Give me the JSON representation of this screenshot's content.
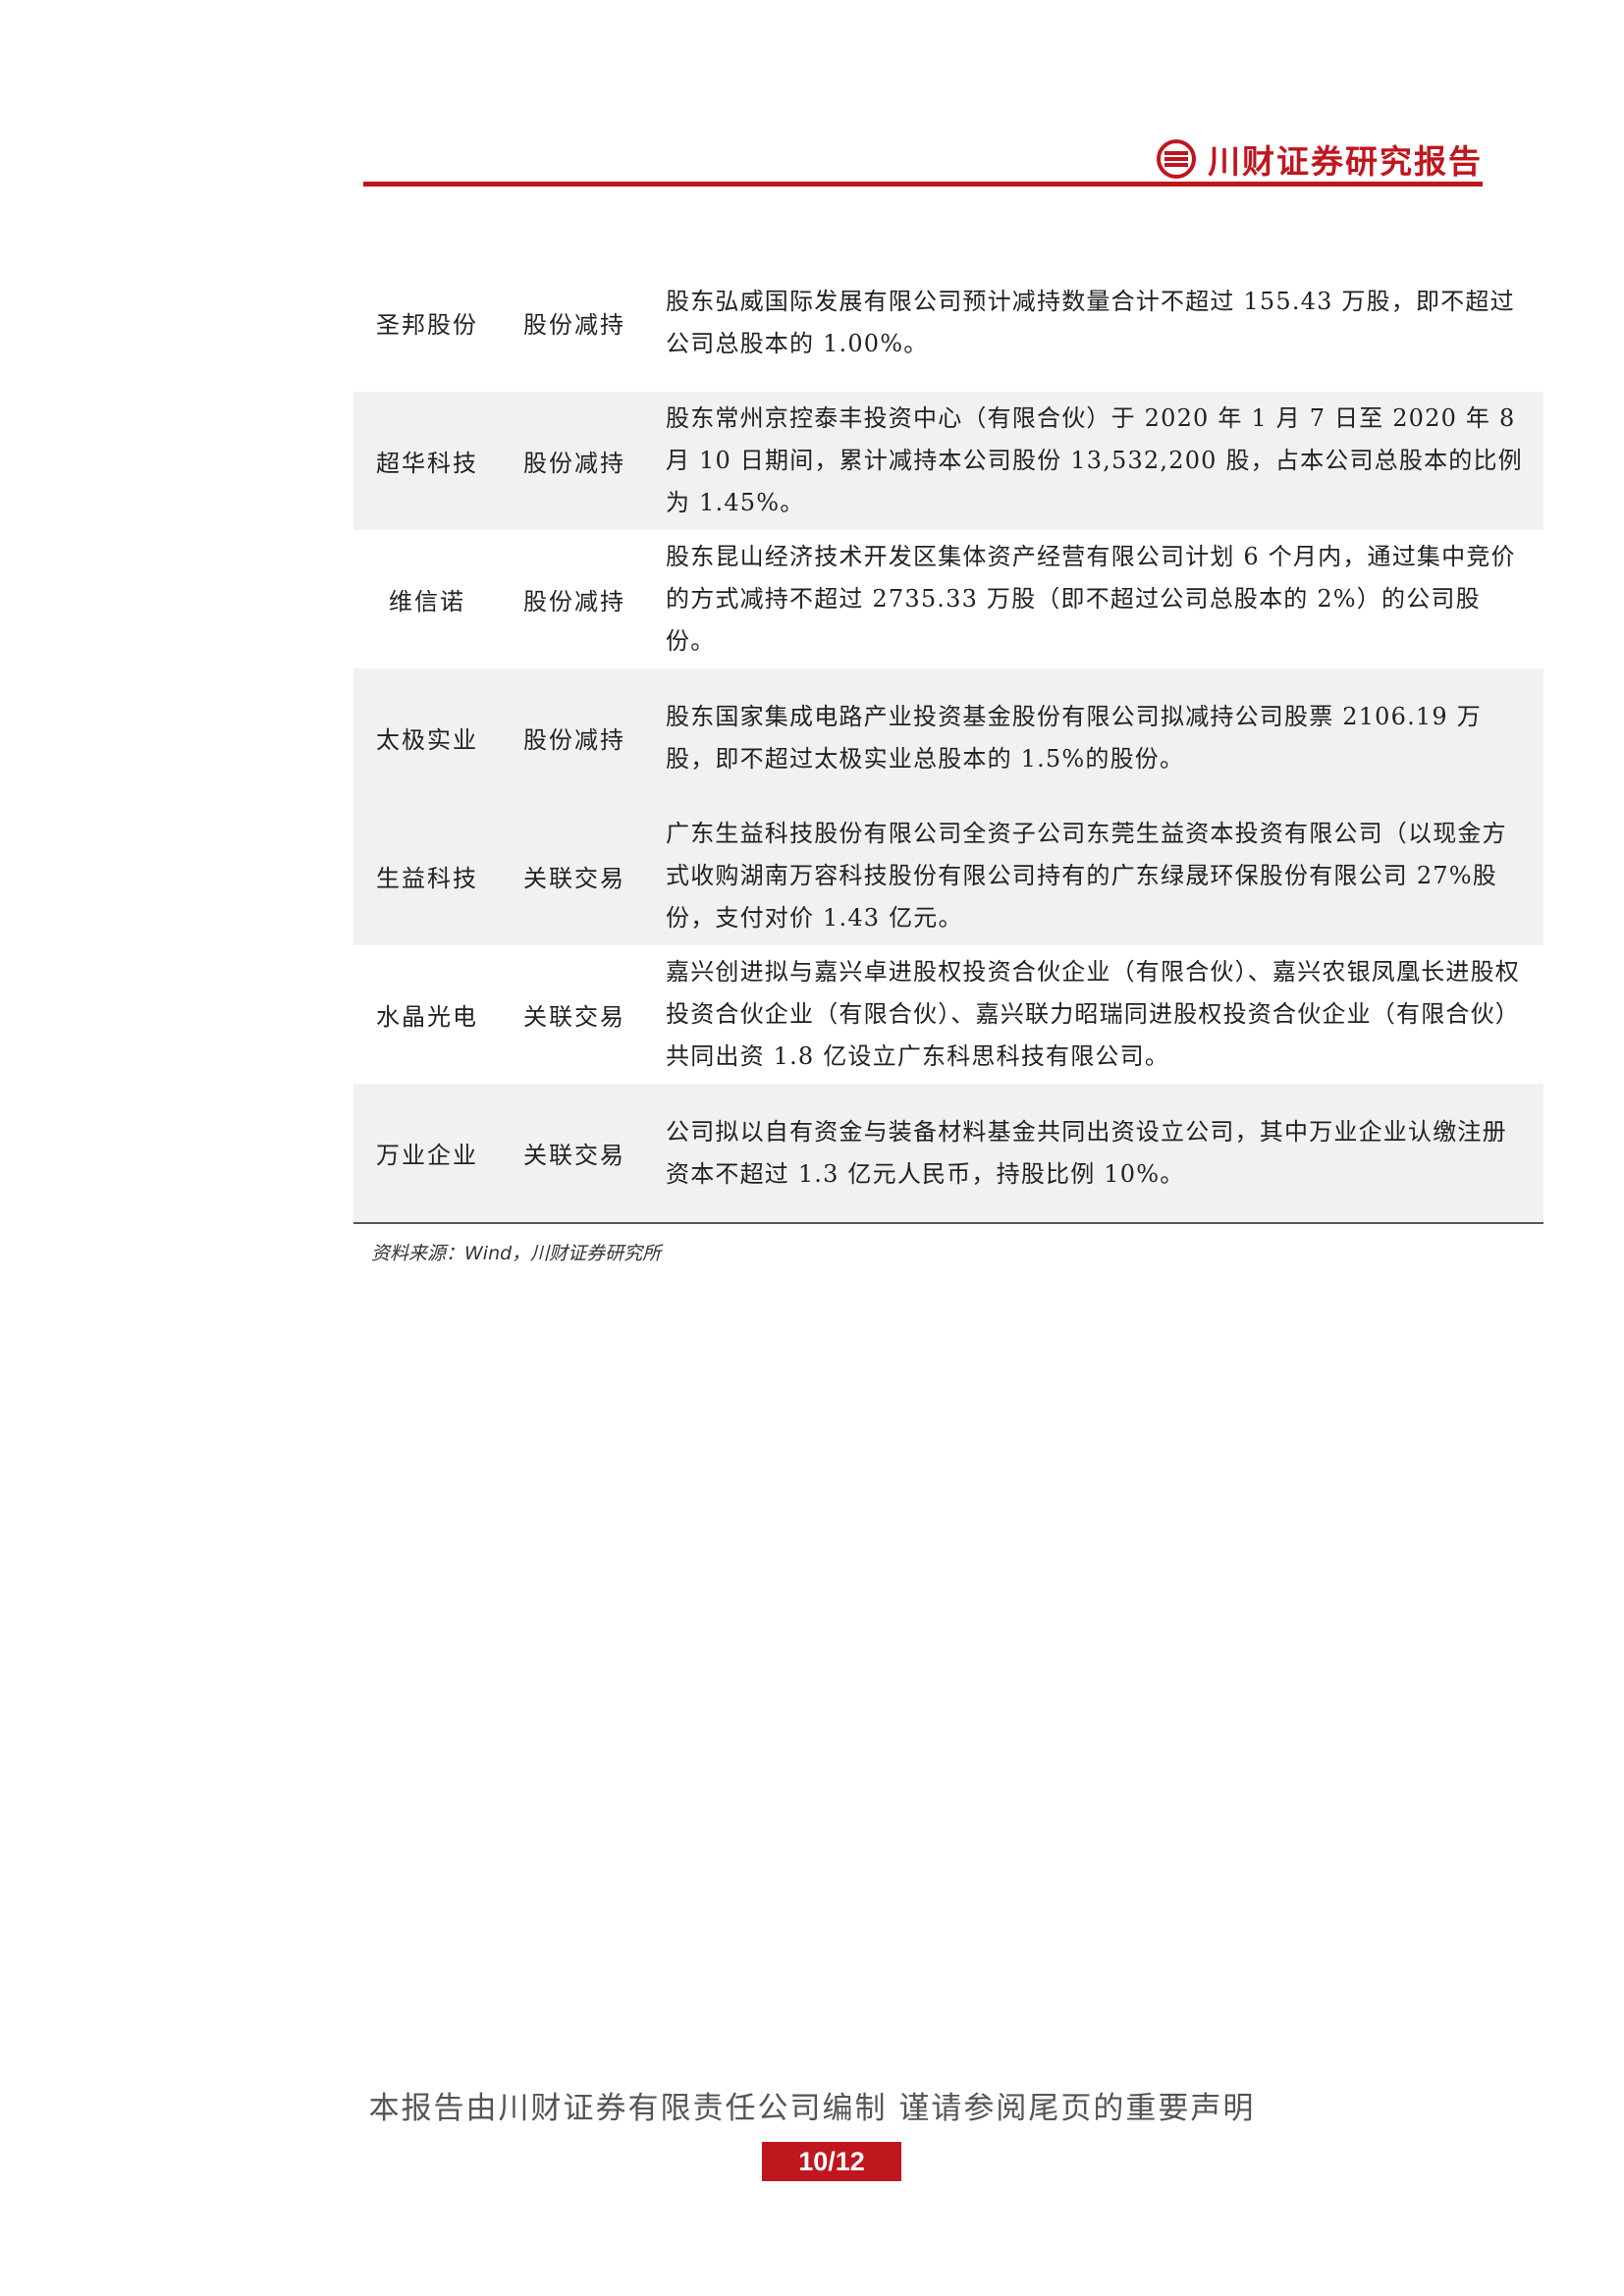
{
  "header": {
    "brand": "川财证券研究报告",
    "accent_color": "#c0161e",
    "logo_icon": "chuancai-logo-icon"
  },
  "table": {
    "rows": [
      {
        "company": "圣邦股份",
        "type": "股份减持",
        "description": "股东弘威国际发展有限公司预计减持数量合计不超过 155.43 万股，即不超过公司总股本的 1.00%。"
      },
      {
        "company": "超华科技",
        "type": "股份减持",
        "description": "股东常州京控泰丰投资中心（有限合伙）于 2020 年 1 月 7 日至 2020 年 8 月 10 日期间，累计减持本公司股份 13,532,200 股，占本公司总股本的比例为 1.45%。"
      },
      {
        "company": "维信诺",
        "type": "股份减持",
        "description": "股东昆山经济技术开发区集体资产经营有限公司计划 6 个月内，通过集中竞价的方式减持不超过 2735.33 万股（即不超过公司总股本的 2%）的公司股份。"
      },
      {
        "company": "太极实业",
        "type": "股份减持",
        "description": "股东国家集成电路产业投资基金股份有限公司拟减持公司股票 2106.19 万股，即不超过太极实业总股本的 1.5%的股份。"
      },
      {
        "company": "生益科技",
        "type": "关联交易",
        "description": "广东生益科技股份有限公司全资子公司东莞生益资本投资有限公司（以现金方式收购湖南万容科技股份有限公司持有的广东绿晟环保股份有限公司 27%股份，支付对价 1.43 亿元。"
      },
      {
        "company": "水晶光电",
        "type": "关联交易",
        "description": "嘉兴创进拟与嘉兴卓进股权投资合伙企业（有限合伙）、嘉兴农银凤凰长进股权投资合伙企业（有限合伙）、嘉兴联力昭瑞同进股权投资合伙企业（有限合伙）共同出资 1.8 亿设立广东科思科技有限公司。"
      },
      {
        "company": "万业企业",
        "type": "关联交易",
        "description": "公司拟以自有资金与装备材料基金共同出资设立公司，其中万业企业认缴注册资本不超过 1.3 亿元人民币，持股比例 10%。"
      }
    ]
  },
  "source": "资料来源：Wind，川财证券研究所",
  "footer": {
    "statement": "本报告由川财证券有限责任公司编制 谨请参阅尾页的重要声明",
    "page": "10/12"
  }
}
